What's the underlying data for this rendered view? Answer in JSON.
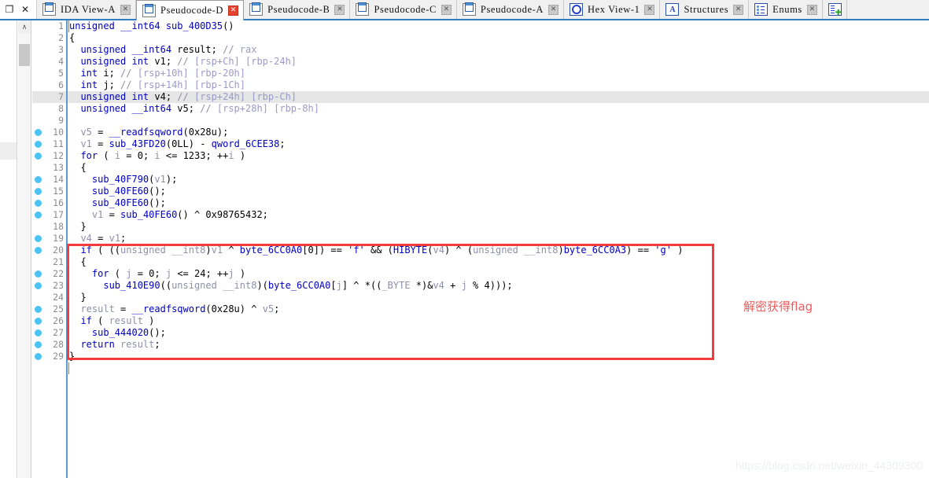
{
  "window": {
    "restore_label": "❐",
    "close_label": "✕"
  },
  "tabs": [
    {
      "label": "IDA View-A",
      "icon": "document-icon",
      "active": false,
      "close": "✕"
    },
    {
      "label": "Pseudocode-D",
      "icon": "document-icon",
      "active": true,
      "close": "✕"
    },
    {
      "label": "Pseudocode-B",
      "icon": "document-icon",
      "active": false,
      "close": "✕"
    },
    {
      "label": "Pseudocode-C",
      "icon": "document-icon",
      "active": false,
      "close": "✕"
    },
    {
      "label": "Pseudocode-A",
      "icon": "document-icon",
      "active": false,
      "close": "✕"
    },
    {
      "label": "Hex View-1",
      "icon": "hex-view-icon",
      "active": false,
      "close": "✕"
    },
    {
      "label": "Structures",
      "icon": "structures-icon",
      "active": false,
      "close": "✕"
    },
    {
      "label": "Enums",
      "icon": "enums-icon",
      "active": false,
      "close": "✕"
    },
    {
      "label": "",
      "icon": "imports-icon",
      "active": false,
      "close": ""
    }
  ],
  "scrollbar": {
    "up_arrow": "∧"
  },
  "editor": {
    "current_line": 7,
    "lines": [
      {
        "n": 1,
        "bp": false,
        "tokens": [
          {
            "t": "unsigned __int64 ",
            "c": "kw"
          },
          {
            "t": "sub_400D35",
            "c": "fn"
          },
          {
            "t": "()",
            "c": "pun"
          }
        ]
      },
      {
        "n": 2,
        "bp": false,
        "tokens": [
          {
            "t": "{",
            "c": "pun"
          }
        ]
      },
      {
        "n": 3,
        "bp": false,
        "tokens": [
          {
            "t": "  unsigned __int64 ",
            "c": "kw"
          },
          {
            "t": "result",
            "c": "plain"
          },
          {
            "t": "; ",
            "c": "pun"
          },
          {
            "t": "// ",
            "c": "cmt"
          },
          {
            "t": "rax",
            "c": "reg"
          }
        ]
      },
      {
        "n": 4,
        "bp": false,
        "tokens": [
          {
            "t": "  unsigned int ",
            "c": "kw"
          },
          {
            "t": "v1",
            "c": "plain"
          },
          {
            "t": "; ",
            "c": "pun"
          },
          {
            "t": "// ",
            "c": "cmt"
          },
          {
            "t": "[rsp+Ch] [rbp-24h]",
            "c": "reg"
          }
        ]
      },
      {
        "n": 5,
        "bp": false,
        "tokens": [
          {
            "t": "  int ",
            "c": "kw"
          },
          {
            "t": "i",
            "c": "plain"
          },
          {
            "t": "; ",
            "c": "pun"
          },
          {
            "t": "// ",
            "c": "cmt"
          },
          {
            "t": "[rsp+10h] [rbp-20h]",
            "c": "reg"
          }
        ]
      },
      {
        "n": 6,
        "bp": false,
        "tokens": [
          {
            "t": "  int ",
            "c": "kw"
          },
          {
            "t": "j",
            "c": "plain"
          },
          {
            "t": "; ",
            "c": "pun"
          },
          {
            "t": "// ",
            "c": "cmt"
          },
          {
            "t": "[rsp+14h] [rbp-1Ch]",
            "c": "reg"
          }
        ]
      },
      {
        "n": 7,
        "bp": false,
        "hl": true,
        "tokens": [
          {
            "t": "  unsigned int ",
            "c": "kw"
          },
          {
            "t": "v4",
            "c": "plain"
          },
          {
            "t": "; ",
            "c": "pun"
          },
          {
            "t": "// ",
            "c": "cmt"
          },
          {
            "t": "[rsp+24h] [rbp-Ch]",
            "c": "reg"
          }
        ]
      },
      {
        "n": 8,
        "bp": false,
        "tokens": [
          {
            "t": "  unsigned __int64 ",
            "c": "kw"
          },
          {
            "t": "v5",
            "c": "plain"
          },
          {
            "t": "; ",
            "c": "pun"
          },
          {
            "t": "// ",
            "c": "cmt"
          },
          {
            "t": "[rsp+28h] [rbp-8h]",
            "c": "reg"
          }
        ]
      },
      {
        "n": 9,
        "bp": false,
        "tokens": []
      },
      {
        "n": 10,
        "bp": true,
        "tokens": [
          {
            "t": "  ",
            "c": "plain"
          },
          {
            "t": "v5",
            "c": "var"
          },
          {
            "t": " = ",
            "c": "pun"
          },
          {
            "t": "__readfsqword",
            "c": "fn"
          },
          {
            "t": "(",
            "c": "pun"
          },
          {
            "t": "0x28u",
            "c": "num"
          },
          {
            "t": ");",
            "c": "pun"
          }
        ]
      },
      {
        "n": 11,
        "bp": true,
        "tokens": [
          {
            "t": "  ",
            "c": "plain"
          },
          {
            "t": "v1",
            "c": "var"
          },
          {
            "t": " = ",
            "c": "pun"
          },
          {
            "t": "sub_43FD20",
            "c": "fn"
          },
          {
            "t": "(",
            "c": "pun"
          },
          {
            "t": "0LL",
            "c": "num"
          },
          {
            "t": ") - ",
            "c": "pun"
          },
          {
            "t": "qword_6CEE38",
            "c": "fn"
          },
          {
            "t": ";",
            "c": "pun"
          }
        ]
      },
      {
        "n": 12,
        "bp": true,
        "tokens": [
          {
            "t": "  for ",
            "c": "kw"
          },
          {
            "t": "( ",
            "c": "pun"
          },
          {
            "t": "i",
            "c": "var"
          },
          {
            "t": " = ",
            "c": "pun"
          },
          {
            "t": "0",
            "c": "num"
          },
          {
            "t": "; ",
            "c": "pun"
          },
          {
            "t": "i",
            "c": "var"
          },
          {
            "t": " <= ",
            "c": "pun"
          },
          {
            "t": "1233",
            "c": "num"
          },
          {
            "t": "; ++",
            "c": "pun"
          },
          {
            "t": "i",
            "c": "var"
          },
          {
            "t": " )",
            "c": "pun"
          }
        ]
      },
      {
        "n": 13,
        "bp": false,
        "tokens": [
          {
            "t": "  {",
            "c": "pun"
          }
        ]
      },
      {
        "n": 14,
        "bp": true,
        "tokens": [
          {
            "t": "    ",
            "c": "plain"
          },
          {
            "t": "sub_40F790",
            "c": "fn"
          },
          {
            "t": "(",
            "c": "pun"
          },
          {
            "t": "v1",
            "c": "var"
          },
          {
            "t": ");",
            "c": "pun"
          }
        ]
      },
      {
        "n": 15,
        "bp": true,
        "tokens": [
          {
            "t": "    ",
            "c": "plain"
          },
          {
            "t": "sub_40FE60",
            "c": "fn"
          },
          {
            "t": "();",
            "c": "pun"
          }
        ]
      },
      {
        "n": 16,
        "bp": true,
        "tokens": [
          {
            "t": "    ",
            "c": "plain"
          },
          {
            "t": "sub_40FE60",
            "c": "fn"
          },
          {
            "t": "();",
            "c": "pun"
          }
        ]
      },
      {
        "n": 17,
        "bp": true,
        "tokens": [
          {
            "t": "    ",
            "c": "plain"
          },
          {
            "t": "v1",
            "c": "var"
          },
          {
            "t": " = ",
            "c": "pun"
          },
          {
            "t": "sub_40FE60",
            "c": "fn"
          },
          {
            "t": "() ^ ",
            "c": "pun"
          },
          {
            "t": "0x98765432",
            "c": "num"
          },
          {
            "t": ";",
            "c": "pun"
          }
        ]
      },
      {
        "n": 18,
        "bp": false,
        "tokens": [
          {
            "t": "  }",
            "c": "pun"
          }
        ]
      },
      {
        "n": 19,
        "bp": true,
        "tokens": [
          {
            "t": "  ",
            "c": "plain"
          },
          {
            "t": "v4",
            "c": "var"
          },
          {
            "t": " = ",
            "c": "pun"
          },
          {
            "t": "v1",
            "c": "var"
          },
          {
            "t": ";",
            "c": "pun"
          }
        ]
      },
      {
        "n": 20,
        "bp": true,
        "tokens": [
          {
            "t": "  if ",
            "c": "kw"
          },
          {
            "t": "( ((",
            "c": "pun"
          },
          {
            "t": "unsigned __int8",
            "c": "var"
          },
          {
            "t": ")",
            "c": "pun"
          },
          {
            "t": "v1",
            "c": "var"
          },
          {
            "t": " ^ ",
            "c": "pun"
          },
          {
            "t": "byte_6CC0A0",
            "c": "fn"
          },
          {
            "t": "[",
            "c": "pun"
          },
          {
            "t": "0",
            "c": "num"
          },
          {
            "t": "]) == ",
            "c": "pun"
          },
          {
            "t": "'f'",
            "c": "str"
          },
          {
            "t": " && (",
            "c": "pun"
          },
          {
            "t": "HIBYTE",
            "c": "fn"
          },
          {
            "t": "(",
            "c": "pun"
          },
          {
            "t": "v4",
            "c": "var"
          },
          {
            "t": ") ^ (",
            "c": "pun"
          },
          {
            "t": "unsigned __int8",
            "c": "var"
          },
          {
            "t": ")",
            "c": "pun"
          },
          {
            "t": "byte_6CC0A3",
            "c": "fn"
          },
          {
            "t": ") == ",
            "c": "pun"
          },
          {
            "t": "'g'",
            "c": "str"
          },
          {
            "t": " )",
            "c": "pun"
          }
        ]
      },
      {
        "n": 21,
        "bp": false,
        "tokens": [
          {
            "t": "  {",
            "c": "pun"
          }
        ]
      },
      {
        "n": 22,
        "bp": true,
        "tokens": [
          {
            "t": "    for ",
            "c": "kw"
          },
          {
            "t": "( ",
            "c": "pun"
          },
          {
            "t": "j",
            "c": "var"
          },
          {
            "t": " = ",
            "c": "pun"
          },
          {
            "t": "0",
            "c": "num"
          },
          {
            "t": "; ",
            "c": "pun"
          },
          {
            "t": "j",
            "c": "var"
          },
          {
            "t": " <= ",
            "c": "pun"
          },
          {
            "t": "24",
            "c": "num"
          },
          {
            "t": "; ++",
            "c": "pun"
          },
          {
            "t": "j",
            "c": "var"
          },
          {
            "t": " )",
            "c": "pun"
          }
        ]
      },
      {
        "n": 23,
        "bp": true,
        "tokens": [
          {
            "t": "      ",
            "c": "plain"
          },
          {
            "t": "sub_410E90",
            "c": "fn"
          },
          {
            "t": "((",
            "c": "pun"
          },
          {
            "t": "unsigned __int8",
            "c": "var"
          },
          {
            "t": ")(",
            "c": "pun"
          },
          {
            "t": "byte_6CC0A0",
            "c": "fn"
          },
          {
            "t": "[",
            "c": "pun"
          },
          {
            "t": "j",
            "c": "var"
          },
          {
            "t": "] ^ *((",
            "c": "pun"
          },
          {
            "t": "_BYTE",
            "c": "var"
          },
          {
            "t": " *)&",
            "c": "pun"
          },
          {
            "t": "v4",
            "c": "var"
          },
          {
            "t": " + ",
            "c": "pun"
          },
          {
            "t": "j",
            "c": "var"
          },
          {
            "t": " % ",
            "c": "pun"
          },
          {
            "t": "4",
            "c": "num"
          },
          {
            "t": ")));",
            "c": "pun"
          }
        ]
      },
      {
        "n": 24,
        "bp": false,
        "tokens": [
          {
            "t": "  }",
            "c": "pun"
          }
        ]
      },
      {
        "n": 25,
        "bp": true,
        "tokens": [
          {
            "t": "  ",
            "c": "plain"
          },
          {
            "t": "result",
            "c": "var"
          },
          {
            "t": " = ",
            "c": "pun"
          },
          {
            "t": "__readfsqword",
            "c": "fn"
          },
          {
            "t": "(",
            "c": "pun"
          },
          {
            "t": "0x28u",
            "c": "num"
          },
          {
            "t": ") ^ ",
            "c": "pun"
          },
          {
            "t": "v5",
            "c": "var"
          },
          {
            "t": ";",
            "c": "pun"
          }
        ]
      },
      {
        "n": 26,
        "bp": true,
        "tokens": [
          {
            "t": "  if ",
            "c": "kw"
          },
          {
            "t": "( ",
            "c": "pun"
          },
          {
            "t": "result",
            "c": "var"
          },
          {
            "t": " )",
            "c": "pun"
          }
        ]
      },
      {
        "n": 27,
        "bp": true,
        "tokens": [
          {
            "t": "    ",
            "c": "plain"
          },
          {
            "t": "sub_444020",
            "c": "fn"
          },
          {
            "t": "();",
            "c": "pun"
          }
        ]
      },
      {
        "n": 28,
        "bp": true,
        "tokens": [
          {
            "t": "  return ",
            "c": "kw"
          },
          {
            "t": "result",
            "c": "var"
          },
          {
            "t": ";",
            "c": "pun"
          }
        ]
      },
      {
        "n": 29,
        "bp": true,
        "tokens": [
          {
            "t": "}",
            "c": "pun"
          }
        ]
      }
    ]
  },
  "annotation": {
    "text": "解密获得flag",
    "color": "#f05a5a"
  },
  "highlight_box": {
    "color": "#f43c3c"
  },
  "watermark": {
    "text": "https://blog.csdn.net/weixin_44309300"
  }
}
